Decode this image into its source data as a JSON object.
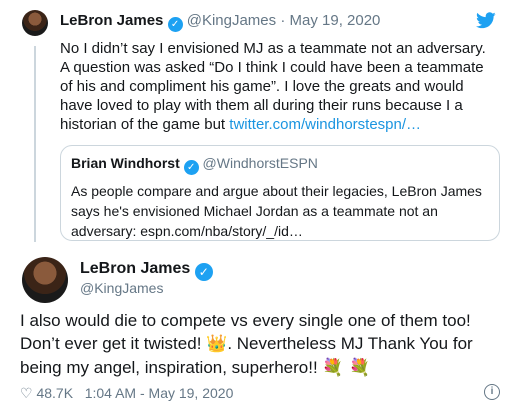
{
  "original_tweet": {
    "name": "LeBron James",
    "handle": "@KingJames",
    "separator": "·",
    "date": "May 19, 2020",
    "text": "No I didn’t say I envisioned MJ as a teammate not an adversary. A question was asked “Do I think I could have been a teammate of his and compliment his game”. I love the greats and would have loved to play with them all during their runs because I a historian of the game but ",
    "link": "twitter.com/windhorstespn/…"
  },
  "quoted_tweet": {
    "name": "Brian Windhorst",
    "handle": "@WindhorstESPN",
    "text": "As people compare and argue about their legacies, LeBron James says he's envisioned Michael Jordan as a teammate not an adversary: espn.com/nba/story/_/id…"
  },
  "reply_tweet": {
    "name": "LeBron James",
    "handle": "@KingJames",
    "text_part1": "I also would die to compete vs every single one of them too! Don’t ever get it twisted! ",
    "emoji_crown": "👑",
    "text_part2": ". Nevertheless MJ Thank You for being my angel, inspiration, superhero!! ",
    "emoji_bouquet": "💐 💐"
  },
  "footer": {
    "likes": "48.7K",
    "timestamp": "1:04 AM - May 19, 2020"
  },
  "colors": {
    "accent": "#1da1f2",
    "link": "#1b95e0",
    "muted": "#657786"
  },
  "icons": [
    "twitter-bird-icon",
    "verified-badge-icon",
    "heart-icon",
    "info-icon"
  ]
}
